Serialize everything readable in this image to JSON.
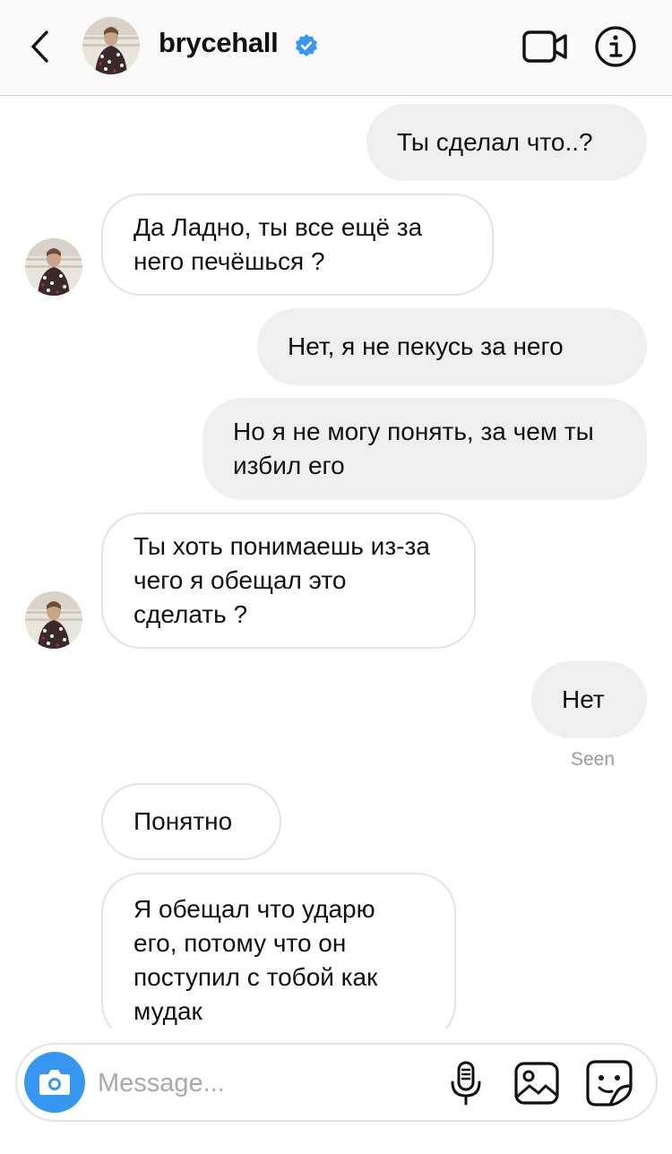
{
  "header": {
    "username": "brycehall",
    "verified": true,
    "icons": {
      "back": "chevron-left-icon",
      "video": "video-camera-icon",
      "info": "info-icon"
    }
  },
  "messages": [
    {
      "from": "me",
      "text": "Ты сделал что..?"
    },
    {
      "from": "them",
      "text": "Да Ладно, ты все ещё за него печёшься ?"
    },
    {
      "from": "me",
      "text": "Нет, я не пекусь за него"
    },
    {
      "from": "me",
      "text": "Но я не могу понять, за чем ты избил его"
    },
    {
      "from": "them",
      "text": "Ты хоть понимаешь из-за чего я обещал это сделать ?"
    },
    {
      "from": "me",
      "text": "Нет"
    },
    {
      "from": "them",
      "text": "Понятно"
    },
    {
      "from": "them",
      "text": "Я обещал что ударю его, потому что он поступил с тобой как мудак"
    }
  ],
  "seen_label": "Seen",
  "composer": {
    "placeholder": "Message...",
    "icons": {
      "camera": "camera-icon",
      "mic": "microphone-icon",
      "gallery": "gallery-icon",
      "sticker": "sticker-icon"
    }
  },
  "colors": {
    "accent": "#3797f0",
    "outgoing_bubble": "#efefef",
    "incoming_border": "#e3e3e3",
    "verified_badge": "#3897f0"
  }
}
